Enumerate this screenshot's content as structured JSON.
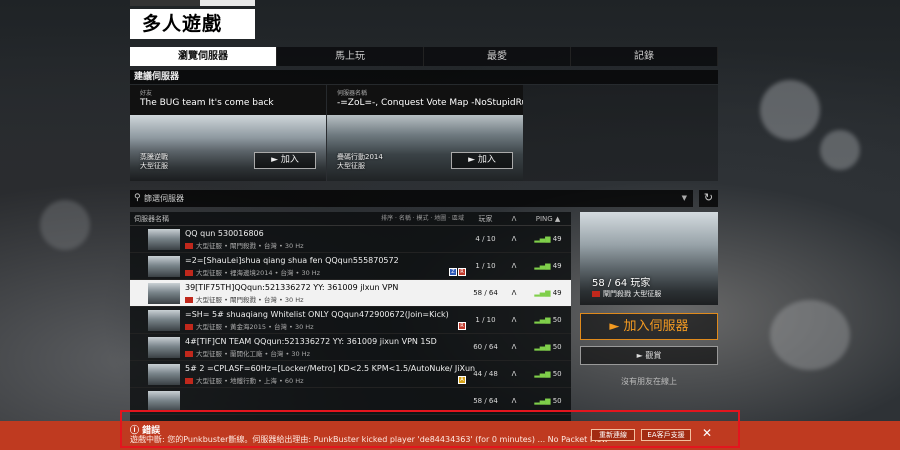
{
  "window": {
    "title": "多人遊戲"
  },
  "tabs": [
    {
      "label": "瀏覽伺服器",
      "active": true
    },
    {
      "label": "馬上玩",
      "active": false
    },
    {
      "label": "最愛",
      "active": false
    },
    {
      "label": "記錄",
      "active": false
    }
  ],
  "recommended": {
    "title": "建議伺服器",
    "cards": [
      {
        "subtitle": "好友",
        "name": "The BUG team It's come back",
        "mode_line1": "蒸騰逆戰",
        "mode_line2": "大型征服",
        "join_label": "► 加入"
      },
      {
        "subtitle": "伺服器名稱",
        "name": "-=ZoL=-, Conquest Vote Map -NoStupidRule...",
        "mode_line1": "疊碼行動2014",
        "mode_line2": "大型征服",
        "join_label": "► 加入"
      }
    ]
  },
  "search": {
    "placeholder": "篩選伺服器",
    "icon": "search-icon",
    "dropdown_icon": "chevron-down-icon",
    "refresh_icon": "refresh-icon"
  },
  "list": {
    "headers": {
      "name": "伺服器名稱",
      "filters": "排序 · 名稱 · 模式 · 地圖 · 區域",
      "players": "玩家",
      "mode_icon": "ᐱ",
      "ping": "PING ▲"
    },
    "rows": [
      {
        "name": "QQ qun 530016806",
        "detail": "大型征服 • 閘門殺戮 • 台灣 • 30 Hz",
        "players": "4 / 10",
        "ping": "49",
        "selected": false,
        "badges": []
      },
      {
        "name": "=2=[ShauLei]shua qiang shua fen QQqun555870572",
        "detail": "大型征服 • 裡海邊境2014 • 台灣 • 30 Hz",
        "players": "1 / 10",
        "ping": "49",
        "selected": false,
        "badges": [
          "Z",
          "R"
        ]
      },
      {
        "name": "39[TIF75TH]QQqun:521336272 YY: 361009 jlxun VPN",
        "detail": "大型征服 • 閘門殺戮 • 台灣 • 30 Hz",
        "players": "58 / 64",
        "ping": "49",
        "selected": true,
        "badges": []
      },
      {
        "name": "=SH= 5# shuaqiang Whitelist ONLY QQqun472900672(Join=Kick)",
        "detail": "大型征服 • 黃金海2015 • 台灣 • 30 Hz",
        "players": "1 / 10",
        "ping": "50",
        "selected": false,
        "badges": [
          "R"
        ]
      },
      {
        "name": "4#[TIF]CN TEAM QQqun:521336272 YY: 361009 jixun VPN 1SD",
        "detail": "大型征服 • 蘭開化工廠 • 台灣 • 30 Hz",
        "players": "60 / 64",
        "ping": "50",
        "selected": false,
        "badges": []
      },
      {
        "name": "5# 2 =CPLASF=60Hz=[Locker/Metro] KD<2.5 KPM<1.5/AutoNuke/ JiXun",
        "detail": "大型征服 • 地鐵行動 • 上海 • 60 Hz",
        "players": "44 / 48",
        "ping": "50",
        "selected": false,
        "badges": [
          "A"
        ]
      },
      {
        "name": "",
        "detail": "",
        "players": "58 / 64",
        "ping": "50",
        "selected": false,
        "badges": []
      }
    ]
  },
  "preview": {
    "players": "58 / 64 玩家",
    "mode": "閘門殺戮  大型征服"
  },
  "actions": {
    "join": "► 加入伺服器",
    "spectate": "► 觀賞",
    "friends": "沒有朋友在線上"
  },
  "error": {
    "title": "錯誤",
    "message": "遊戲中斷: 您的Punkbuster斷線。伺服器給出理由: PunkBuster kicked player 'de84434363' (for 0 minutes) ... No Packet Flow",
    "retry": "重新連線",
    "help": "EA客戶支援",
    "close": "✕"
  },
  "colors": {
    "accent": "#f39a21",
    "error_bar": "#bf3a20",
    "highlight_outline": "#e3151e",
    "ping": "#7fcf4a"
  }
}
